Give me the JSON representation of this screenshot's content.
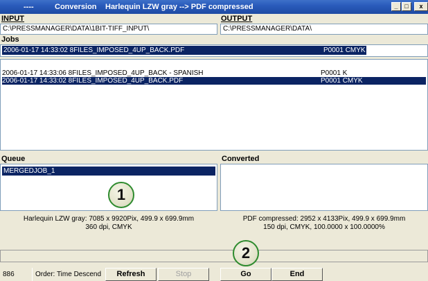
{
  "titlebar": {
    "prefix": "----",
    "mode": "Conversion",
    "title": "Harlequin LZW gray --> PDF compressed",
    "minimize": "_",
    "maximize": "□",
    "close": "x"
  },
  "input": {
    "label": "INPUT",
    "path": "C:\\PRESSMANAGER\\DATA\\1BIT-TIFF_INPUT\\"
  },
  "output": {
    "label": "OUTPUT",
    "path": "C:\\PRESSMANAGER\\DATA\\"
  },
  "jobs": {
    "label": "Jobs",
    "current": {
      "name": "2006-01-17  14:33:02  8FILES_IMPOSED_4UP_BACK.PDF",
      "profile": "P0001 CMYK"
    },
    "items": [
      {
        "name": "2006-01-17  14:33:06  8FILES_IMPOSED_4UP_BACK - SPANISH",
        "profile": "P0001 K",
        "selected": false
      },
      {
        "name": "2006-01-17  14:33:02  8FILES_IMPOSED_4UP_BACK.PDF",
        "profile": "P0001 CMYK",
        "selected": true
      }
    ]
  },
  "queue": {
    "label": "Queue",
    "items": [
      "MERGEDJOB_1"
    ],
    "info_line1": "Harlequin LZW gray: 7085 x  9920Pix, 499.9 x 699.9mm",
    "info_line2": "360 dpi, CMYK"
  },
  "converted": {
    "label": "Converted",
    "items": [],
    "info_line1": "PDF compressed: 2952 x  4133Pix, 499.9 x 699.9mm",
    "info_line2": "150 dpi, CMYK, 100.0000 x 100.0000%"
  },
  "statusbar": {
    "count": "886",
    "order": "Order: Time Descend",
    "refresh": "Refresh",
    "stop": "Stop",
    "go": "Go",
    "end": "End"
  },
  "callouts": [
    "1",
    "2"
  ]
}
